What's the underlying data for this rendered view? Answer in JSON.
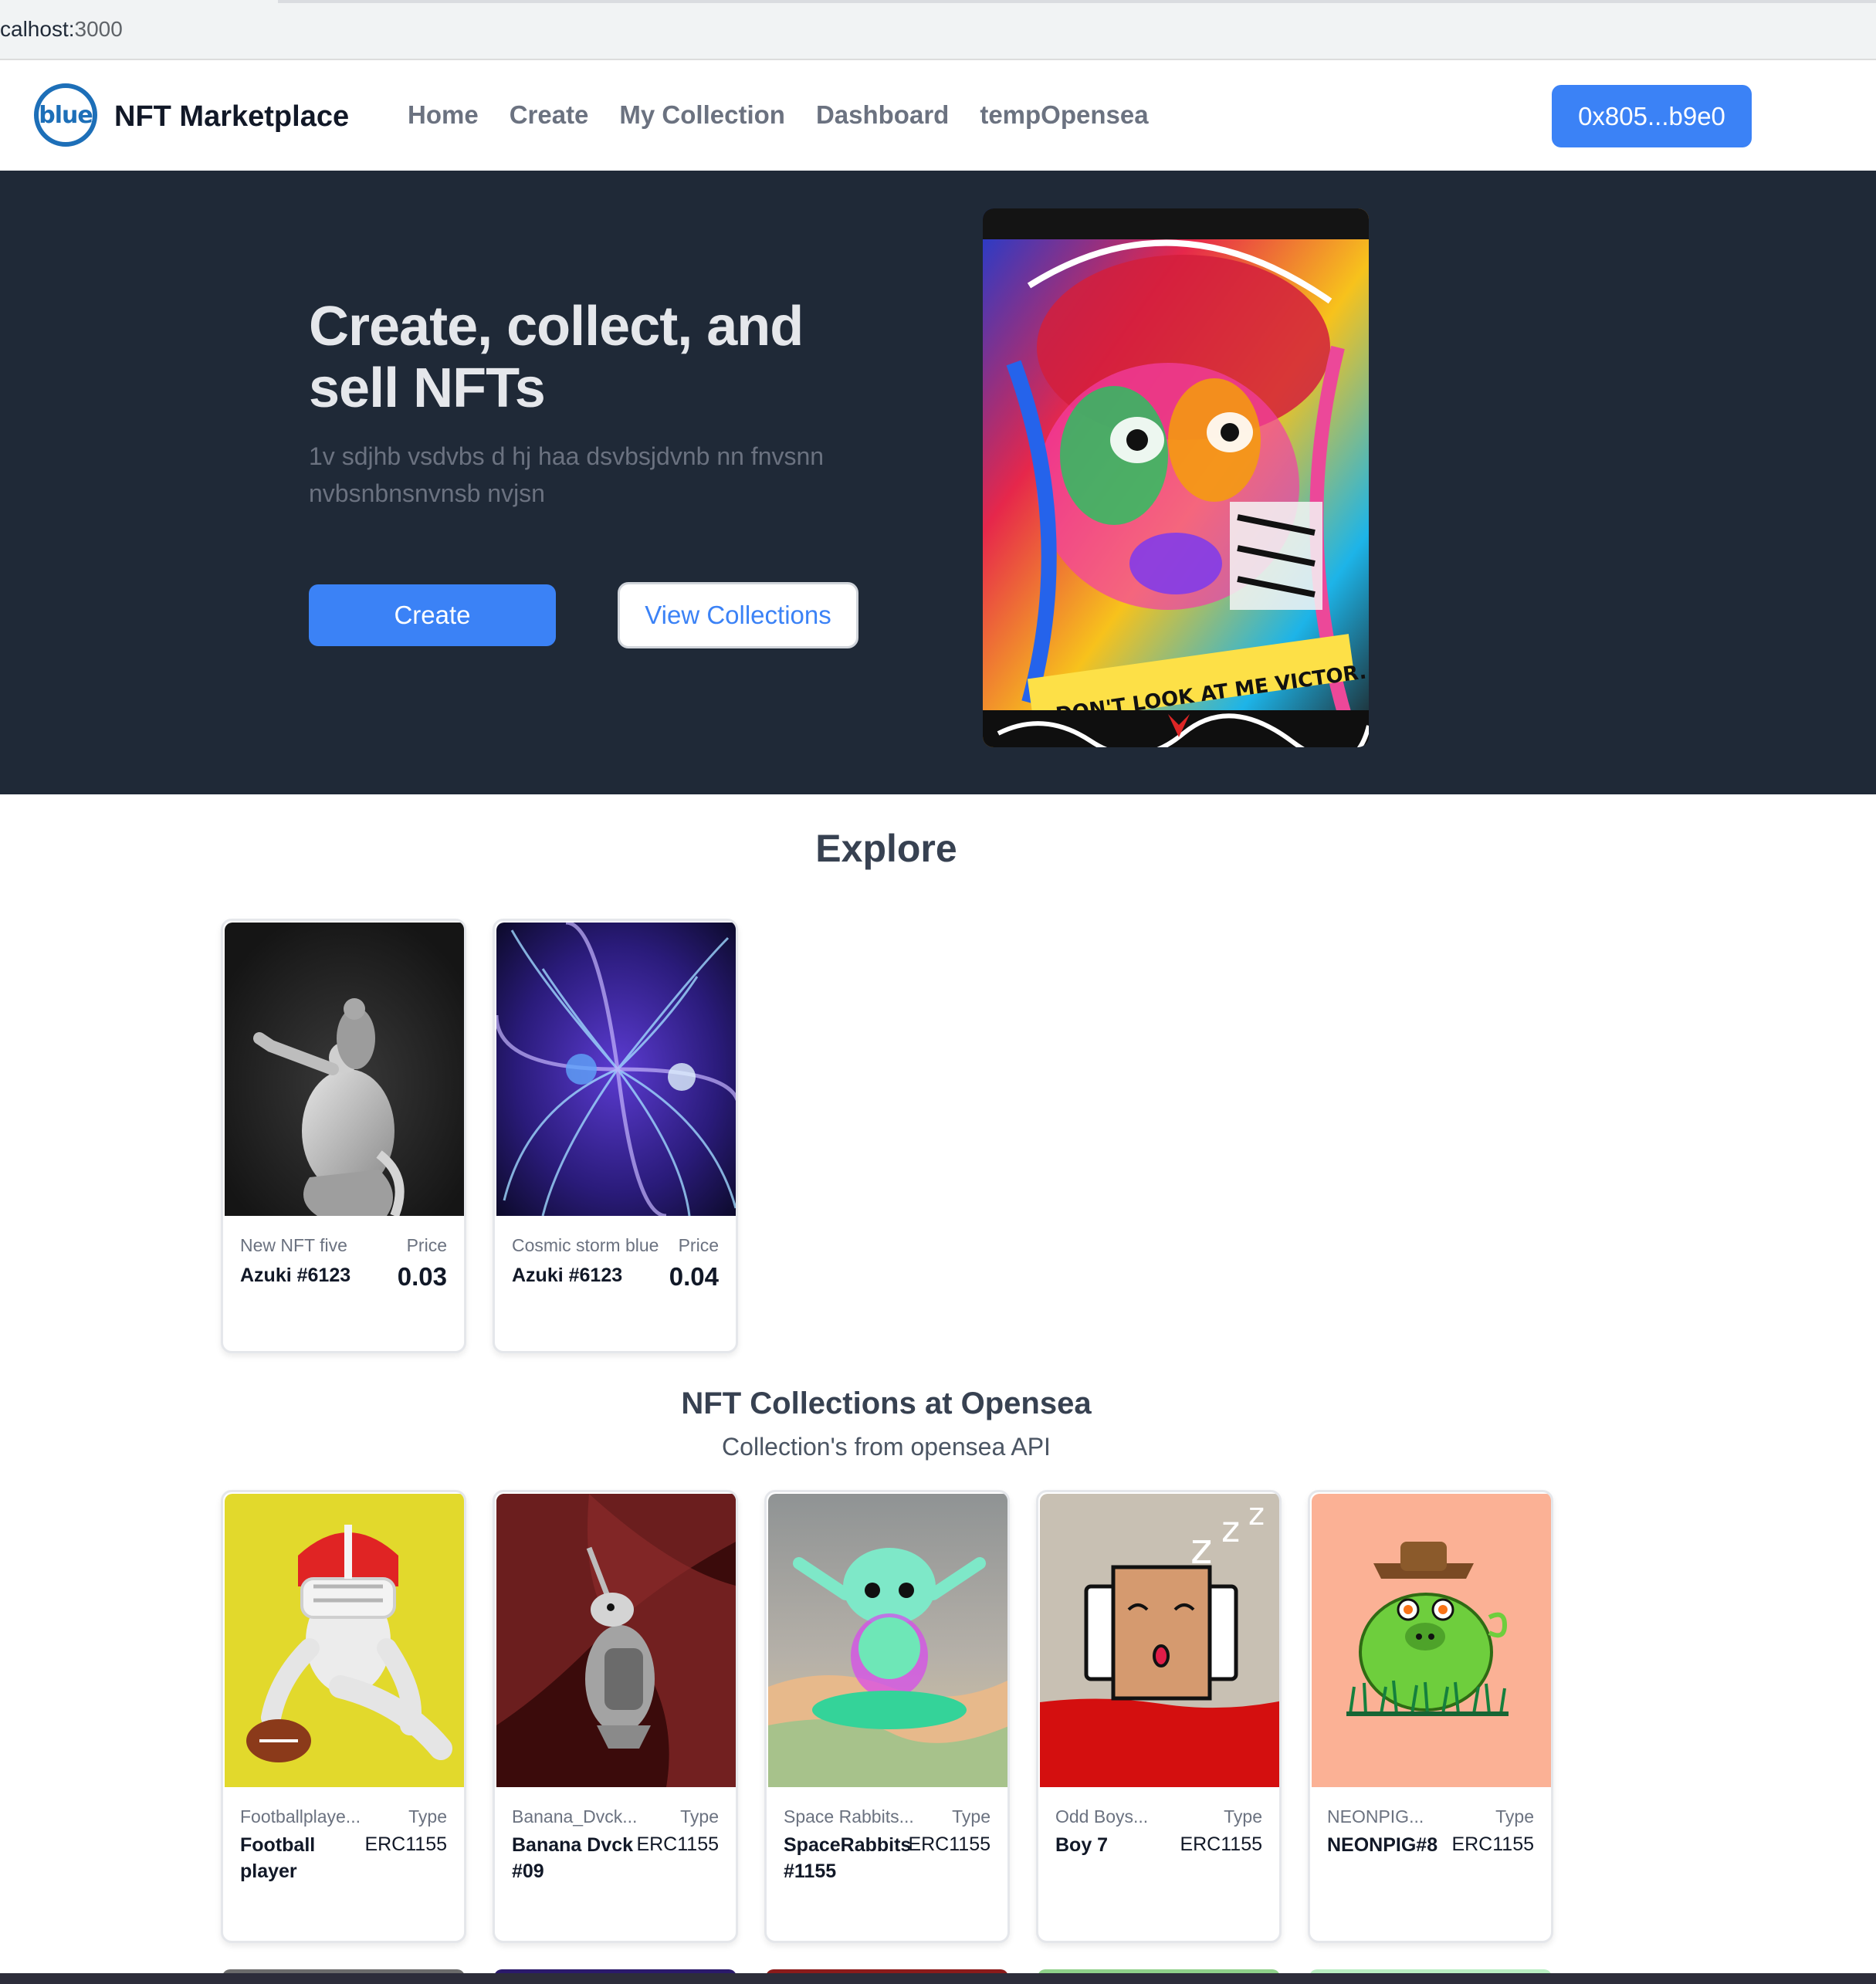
{
  "browser": {
    "url_host": "calhost:",
    "url_port": "3000"
  },
  "header": {
    "logo_text": "blue",
    "brand": "NFT Marketplace",
    "nav": [
      "Home",
      "Create",
      "My Collection",
      "Dashboard",
      "tempOpensea"
    ],
    "wallet": "0x805...b9e0",
    "accent_color": "#3b82f6"
  },
  "hero": {
    "title": "Create, collect, and sell NFTs",
    "subtitle": "1v sdjhb vsdvbs d hj haa dsvbsjdvnb nn fnvsnn nvbsnbnsnvnsb nvjsn",
    "create_label": "Create",
    "view_label": "View Collections",
    "art_caption": "DON'T LOOK AT ME VICTOR."
  },
  "explore": {
    "title": "Explore",
    "items": [
      {
        "name": "New NFT five",
        "price_label": "Price",
        "token": "Azuki #6123",
        "price": "0.03"
      },
      {
        "name": "Cosmic storm blue",
        "price_label": "Price",
        "token": "Azuki #6123",
        "price": "0.04"
      }
    ]
  },
  "collections": {
    "title": "NFT Collections at Opensea",
    "subtitle": "Collection's from opensea API",
    "items": [
      {
        "collection": "Footballplaye...",
        "type_label": "Type",
        "name": "Football player",
        "type": "ERC1155"
      },
      {
        "collection": "Banana_Dvck...",
        "type_label": "Type",
        "name": "Banana Dvck #09",
        "type": "ERC1155"
      },
      {
        "collection": "Space Rabbits...",
        "type_label": "Type",
        "name": "SpaceRabbits #1155",
        "type": "ERC1155"
      },
      {
        "collection": "Odd Boys...",
        "type_label": "Type",
        "name": "Boy 7",
        "type": "ERC1155"
      },
      {
        "collection": "NEONPIG...",
        "type_label": "Type",
        "name": "NEONPIG#8",
        "type": "ERC1155"
      }
    ]
  }
}
